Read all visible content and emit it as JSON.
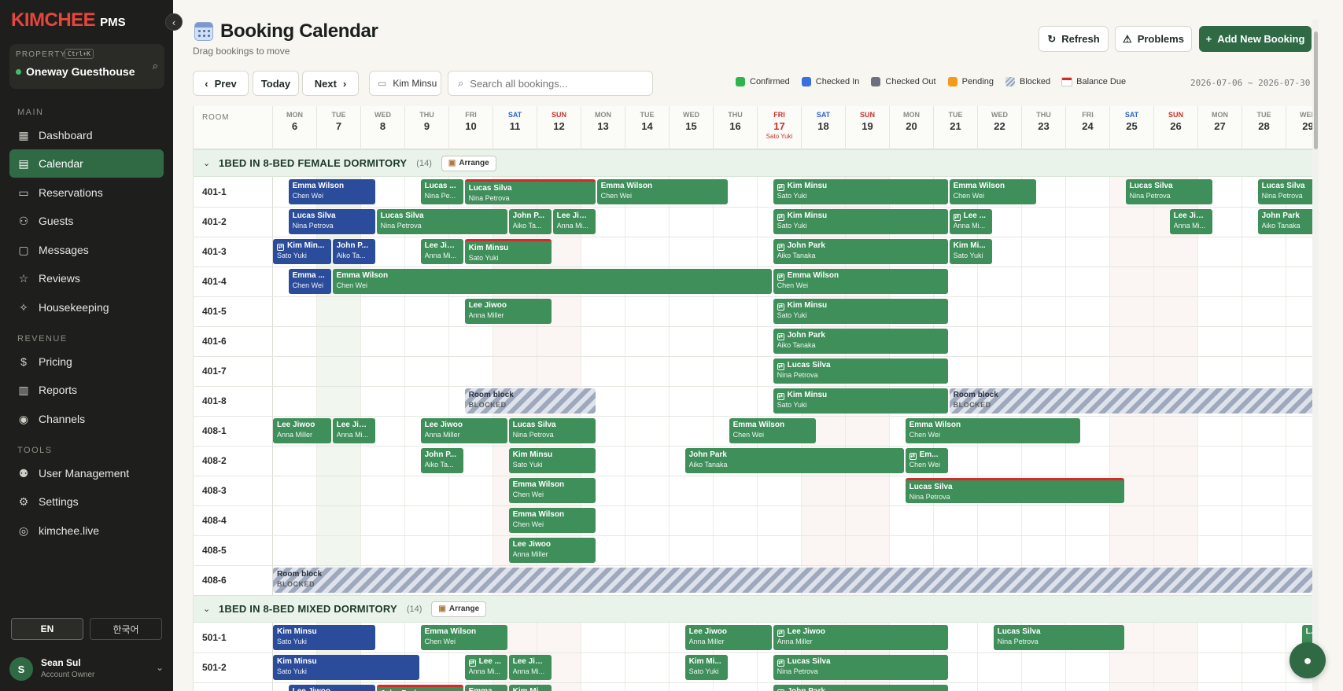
{
  "app": {
    "logo": "KIMCHEE",
    "logo_sub": "PMS"
  },
  "sidebar": {
    "property_label": "PROPERTY",
    "property_shortcut": "Ctrl+K",
    "property_name": "Oneway Guesthouse",
    "sections": {
      "main": "MAIN",
      "revenue": "REVENUE",
      "tools": "TOOLS"
    },
    "items": [
      {
        "label": "Dashboard",
        "icon": "grid-icon"
      },
      {
        "label": "Calendar",
        "icon": "calendar-icon"
      },
      {
        "label": "Reservations",
        "icon": "clipboard-icon"
      },
      {
        "label": "Guests",
        "icon": "users-icon"
      },
      {
        "label": "Messages",
        "icon": "message-icon"
      },
      {
        "label": "Reviews",
        "icon": "star-icon"
      },
      {
        "label": "Housekeeping",
        "icon": "sparkle-icon"
      },
      {
        "label": "Pricing",
        "icon": "dollar-icon"
      },
      {
        "label": "Reports",
        "icon": "bar-chart-icon"
      },
      {
        "label": "Channels",
        "icon": "broadcast-icon"
      },
      {
        "label": "User Management",
        "icon": "user-cog-icon"
      },
      {
        "label": "Settings",
        "icon": "gear-icon"
      },
      {
        "label": "kimchee.live",
        "icon": "globe-icon"
      }
    ],
    "lang_en": "EN",
    "lang_ko": "한국어",
    "user": {
      "initial": "S",
      "name": "Sean Sul",
      "role": "Account Owner"
    }
  },
  "header": {
    "title": "Booking Calendar",
    "subtitle": "Drag bookings to move",
    "refresh": "Refresh",
    "problems": "Problems",
    "add": "Add New Booking"
  },
  "toolbar": {
    "prev": "Prev",
    "today": "Today",
    "next": "Next",
    "filter": "Kim Minsu",
    "search_placeholder": "Search all bookings...",
    "date_range": "2026-07-06 ~ 2026-07-30"
  },
  "legend": [
    {
      "label": "Confirmed",
      "color": "#2fb34f"
    },
    {
      "label": "Checked In",
      "color": "#3a6fe0"
    },
    {
      "label": "Checked Out",
      "color": "#6b7180"
    },
    {
      "label": "Pending",
      "color": "#f29a1a"
    },
    {
      "label": "Blocked",
      "color": "hatch"
    },
    {
      "label": "Balance Due",
      "color": "#d42a2a"
    }
  ],
  "calendar": {
    "room_header": "ROOM",
    "days": [
      {
        "dow": "MON",
        "day": "6"
      },
      {
        "dow": "TUE",
        "day": "7"
      },
      {
        "dow": "WED",
        "day": "8"
      },
      {
        "dow": "THU",
        "day": "9"
      },
      {
        "dow": "FRI",
        "day": "10"
      },
      {
        "dow": "SAT",
        "day": "11"
      },
      {
        "dow": "SUN",
        "day": "12"
      },
      {
        "dow": "MON",
        "day": "13"
      },
      {
        "dow": "TUE",
        "day": "14"
      },
      {
        "dow": "WED",
        "day": "15"
      },
      {
        "dow": "THU",
        "day": "16"
      },
      {
        "dow": "FRI",
        "day": "17",
        "note": "Sato Yuki"
      },
      {
        "dow": "SAT",
        "day": "18"
      },
      {
        "dow": "SUN",
        "day": "19"
      },
      {
        "dow": "MON",
        "day": "20"
      },
      {
        "dow": "TUE",
        "day": "21"
      },
      {
        "dow": "WED",
        "day": "22"
      },
      {
        "dow": "THU",
        "day": "23"
      },
      {
        "dow": "FRI",
        "day": "24"
      },
      {
        "dow": "SAT",
        "day": "25"
      },
      {
        "dow": "SUN",
        "day": "26"
      },
      {
        "dow": "MON",
        "day": "27"
      },
      {
        "dow": "TUE",
        "day": "28"
      },
      {
        "dow": "WED",
        "day": "29"
      }
    ],
    "today_index": 1,
    "arrange_label": "Arrange",
    "sections": [
      {
        "title": "1BED IN 8-BED FEMALE DORMITORY",
        "count": "(14)",
        "rooms": [
          "401-1",
          "401-2",
          "401-3",
          "401-4",
          "401-5",
          "401-6",
          "401-7",
          "401-8",
          "408-1",
          "408-2",
          "408-3",
          "408-4",
          "408-5",
          "408-6"
        ]
      },
      {
        "title": "1BED IN 8-BED MIXED DORMITORY",
        "count": "(14)",
        "rooms": [
          "501-1",
          "501-2",
          "501-3"
        ]
      }
    ],
    "bookings": [
      {
        "row": 0,
        "s": 0.35,
        "e": 2.35,
        "t": "i",
        "n": "Emma Wilson",
        "g": "Chen Wei"
      },
      {
        "row": 0,
        "s": 3.35,
        "e": 4.35,
        "t": "c",
        "n": "Lucas ...",
        "g": "Nina Pe..."
      },
      {
        "row": 0,
        "s": 4.35,
        "e": 7.35,
        "t": "c",
        "n": "Lucas Silva",
        "g": "Nina Petrova",
        "due": true
      },
      {
        "row": 0,
        "s": 7.35,
        "e": 10.35,
        "t": "c",
        "n": "Emma Wilson",
        "g": "Chen Wei"
      },
      {
        "row": 0,
        "s": 11.35,
        "e": 15.35,
        "t": "c",
        "n": "Kim Minsu",
        "g": "Sato Yuki",
        "ic": true
      },
      {
        "row": 0,
        "s": 15.35,
        "e": 17.35,
        "t": "c",
        "n": "Emma Wilson",
        "g": "Chen Wei"
      },
      {
        "row": 0,
        "s": 19.35,
        "e": 21.35,
        "t": "c",
        "n": "Lucas Silva",
        "g": "Nina Petrova"
      },
      {
        "row": 0,
        "s": 22.35,
        "e": 24.0,
        "t": "c",
        "n": "Lucas Silva",
        "g": "Nina Petrova"
      },
      {
        "row": 1,
        "s": 0.35,
        "e": 2.35,
        "t": "i",
        "n": "Lucas Silva",
        "g": "Nina Petrova"
      },
      {
        "row": 1,
        "s": 2.35,
        "e": 5.35,
        "t": "c",
        "n": "Lucas Silva",
        "g": "Nina Petrova"
      },
      {
        "row": 1,
        "s": 5.35,
        "e": 6.35,
        "t": "c",
        "n": "John P...",
        "g": "Aiko Ta..."
      },
      {
        "row": 1,
        "s": 6.35,
        "e": 7.35,
        "t": "c",
        "n": "Lee Jiw...",
        "g": "Anna Mi..."
      },
      {
        "row": 1,
        "s": 11.35,
        "e": 15.35,
        "t": "c",
        "n": "Kim Minsu",
        "g": "Sato Yuki",
        "ic": true
      },
      {
        "row": 1,
        "s": 15.35,
        "e": 16.35,
        "t": "c",
        "n": "Lee ...",
        "g": "Anna Mi...",
        "ic": true
      },
      {
        "row": 1,
        "s": 20.35,
        "e": 21.35,
        "t": "c",
        "n": "Lee Jiw...",
        "g": "Anna Mi..."
      },
      {
        "row": 1,
        "s": 22.35,
        "e": 24.0,
        "t": "c",
        "n": "John Park",
        "g": "Aiko Tanaka"
      },
      {
        "row": 2,
        "s": 0.0,
        "e": 1.35,
        "t": "i",
        "n": "Kim Min...",
        "g": "Sato Yuki",
        "ic": true
      },
      {
        "row": 2,
        "s": 1.35,
        "e": 2.35,
        "t": "i",
        "n": "John P...",
        "g": "Aiko Ta..."
      },
      {
        "row": 2,
        "s": 3.35,
        "e": 4.35,
        "t": "c",
        "n": "Lee Jiw...",
        "g": "Anna Mi..."
      },
      {
        "row": 2,
        "s": 4.35,
        "e": 6.35,
        "t": "c",
        "n": "Kim Minsu",
        "g": "Sato Yuki",
        "due": true
      },
      {
        "row": 2,
        "s": 11.35,
        "e": 15.35,
        "t": "c",
        "n": "John Park",
        "g": "Aiko Tanaka",
        "ic": true
      },
      {
        "row": 2,
        "s": 15.35,
        "e": 16.35,
        "t": "c",
        "n": "Kim Mi...",
        "g": "Sato Yuki"
      },
      {
        "row": 3,
        "s": 0.35,
        "e": 1.35,
        "t": "i",
        "n": "Emma ...",
        "g": "Chen Wei"
      },
      {
        "row": 3,
        "s": 1.35,
        "e": 11.35,
        "t": "c",
        "n": "Emma Wilson",
        "g": "Chen Wei"
      },
      {
        "row": 3,
        "s": 11.35,
        "e": 15.35,
        "t": "c",
        "n": "Emma Wilson",
        "g": "Chen Wei",
        "ic": true
      },
      {
        "row": 4,
        "s": 4.35,
        "e": 6.35,
        "t": "c",
        "n": "Lee Jiwoo",
        "g": "Anna Miller"
      },
      {
        "row": 4,
        "s": 11.35,
        "e": 15.35,
        "t": "c",
        "n": "Kim Minsu",
        "g": "Sato Yuki",
        "ic": true
      },
      {
        "row": 5,
        "s": 11.35,
        "e": 15.35,
        "t": "c",
        "n": "John Park",
        "g": "Aiko Tanaka",
        "ic": true
      },
      {
        "row": 6,
        "s": 11.35,
        "e": 15.35,
        "t": "c",
        "n": "Lucas Silva",
        "g": "Nina Petrova",
        "ic": true
      },
      {
        "row": 7,
        "s": 4.35,
        "e": 7.35,
        "t": "b",
        "n": "Room block",
        "g": "BLOCKED"
      },
      {
        "row": 7,
        "s": 11.35,
        "e": 15.35,
        "t": "c",
        "n": "Kim Minsu",
        "g": "Sato Yuki",
        "ic": true
      },
      {
        "row": 7,
        "s": 15.35,
        "e": 24.0,
        "t": "b",
        "n": "Room block",
        "g": "BLOCKED"
      },
      {
        "row": 8,
        "s": 0.0,
        "e": 1.35,
        "t": "c",
        "n": "Lee Jiwoo",
        "g": "Anna Miller"
      },
      {
        "row": 8,
        "s": 1.35,
        "e": 2.35,
        "t": "c",
        "n": "Lee Jiw...",
        "g": "Anna Mi..."
      },
      {
        "row": 8,
        "s": 3.35,
        "e": 5.35,
        "t": "c",
        "n": "Lee Jiwoo",
        "g": "Anna Miller"
      },
      {
        "row": 8,
        "s": 5.35,
        "e": 7.35,
        "t": "c",
        "n": "Lucas Silva",
        "g": "Nina Petrova"
      },
      {
        "row": 8,
        "s": 10.35,
        "e": 12.35,
        "t": "c",
        "n": "Emma Wilson",
        "g": "Chen Wei"
      },
      {
        "row": 8,
        "s": 14.35,
        "e": 18.35,
        "t": "c",
        "n": "Emma Wilson",
        "g": "Chen Wei"
      },
      {
        "row": 9,
        "s": 3.35,
        "e": 4.35,
        "t": "c",
        "n": "John P...",
        "g": "Aiko Ta..."
      },
      {
        "row": 9,
        "s": 5.35,
        "e": 7.35,
        "t": "c",
        "n": "Kim Minsu",
        "g": "Sato Yuki"
      },
      {
        "row": 9,
        "s": 9.35,
        "e": 14.35,
        "t": "c",
        "n": "John Park",
        "g": "Aiko Tanaka"
      },
      {
        "row": 9,
        "s": 14.35,
        "e": 15.35,
        "t": "c",
        "n": "Em...",
        "g": "Chen Wei",
        "ic": true
      },
      {
        "row": 10,
        "s": 5.35,
        "e": 7.35,
        "t": "c",
        "n": "Emma Wilson",
        "g": "Chen Wei"
      },
      {
        "row": 10,
        "s": 14.35,
        "e": 19.35,
        "t": "c",
        "n": "Lucas Silva",
        "g": "Nina Petrova",
        "due": true
      },
      {
        "row": 11,
        "s": 5.35,
        "e": 7.35,
        "t": "c",
        "n": "Emma Wilson",
        "g": "Chen Wei"
      },
      {
        "row": 12,
        "s": 5.35,
        "e": 7.35,
        "t": "c",
        "n": "Lee Jiwoo",
        "g": "Anna Miller"
      },
      {
        "row": 13,
        "s": 0.0,
        "e": 24.0,
        "t": "b",
        "n": "Room block",
        "g": "BLOCKED"
      },
      {
        "row": 14,
        "s": 0.0,
        "e": 2.35,
        "t": "i",
        "n": "Kim Minsu",
        "g": "Sato Yuki"
      },
      {
        "row": 14,
        "s": 3.35,
        "e": 5.35,
        "t": "c",
        "n": "Emma Wilson",
        "g": "Chen Wei"
      },
      {
        "row": 14,
        "s": 9.35,
        "e": 11.35,
        "t": "c",
        "n": "Lee Jiwoo",
        "g": "Anna Miller"
      },
      {
        "row": 14,
        "s": 11.35,
        "e": 15.35,
        "t": "c",
        "n": "Lee Jiwoo",
        "g": "Anna Miller",
        "ic": true
      },
      {
        "row": 14,
        "s": 16.35,
        "e": 19.35,
        "t": "c",
        "n": "Lucas Silva",
        "g": "Nina Petrova"
      },
      {
        "row": 14,
        "s": 23.35,
        "e": 24.0,
        "t": "c",
        "n": "L...",
        "g": ""
      },
      {
        "row": 15,
        "s": 0.0,
        "e": 3.35,
        "t": "i",
        "n": "Kim Minsu",
        "g": "Sato Yuki"
      },
      {
        "row": 15,
        "s": 4.35,
        "e": 5.35,
        "t": "c",
        "n": "Lee ...",
        "g": "Anna Mi...",
        "ic": true
      },
      {
        "row": 15,
        "s": 5.35,
        "e": 6.35,
        "t": "c",
        "n": "Lee Jiw...",
        "g": "Anna Mi..."
      },
      {
        "row": 15,
        "s": 9.35,
        "e": 10.35,
        "t": "c",
        "n": "Kim Mi...",
        "g": "Sato Yuki"
      },
      {
        "row": 15,
        "s": 11.35,
        "e": 15.35,
        "t": "c",
        "n": "Lucas Silva",
        "g": "Nina Petrova",
        "ic": true
      },
      {
        "row": 16,
        "s": 0.35,
        "e": 2.35,
        "t": "i",
        "n": "Lee Jiwoo",
        "g": ""
      },
      {
        "row": 16,
        "s": 2.35,
        "e": 4.35,
        "t": "c",
        "n": "John Park",
        "g": "",
        "due": true
      },
      {
        "row": 16,
        "s": 4.35,
        "e": 5.35,
        "t": "c",
        "n": "Emma ...",
        "g": ""
      },
      {
        "row": 16,
        "s": 5.35,
        "e": 6.35,
        "t": "c",
        "n": "Kim Mi...",
        "g": ""
      },
      {
        "row": 16,
        "s": 11.35,
        "e": 15.35,
        "t": "c",
        "n": "John Park",
        "g": "",
        "ic": true
      }
    ]
  }
}
